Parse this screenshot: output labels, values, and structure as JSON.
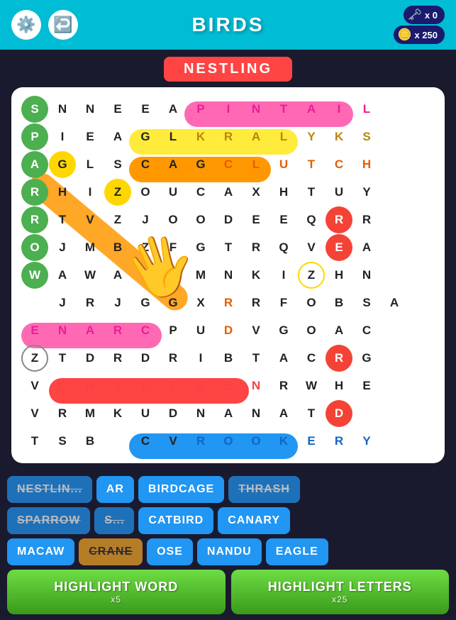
{
  "header": {
    "title": "BIRDS",
    "icons": {
      "settings": "⚙",
      "back": "↩"
    },
    "scores": {
      "key_icon": "🗝",
      "key_count": "x 0",
      "coin_icon": "🪙",
      "coin_count": "x 250"
    }
  },
  "word_label": "NESTLING",
  "grid": {
    "rows": [
      [
        "S",
        "N",
        "N",
        "E",
        "E",
        "A",
        "P",
        "I",
        "N",
        "T",
        "A",
        "I",
        "L",
        " "
      ],
      [
        "P",
        "I",
        "E",
        "A",
        "G",
        "L",
        "K",
        "R",
        "A",
        "L",
        "Y",
        "K",
        "S",
        " "
      ],
      [
        "A",
        "G",
        "L",
        "S",
        "C",
        "A",
        "G",
        "C",
        "L",
        "U",
        "T",
        "C",
        "H",
        " "
      ],
      [
        "R",
        "H",
        "I",
        "Z",
        "O",
        "U",
        "C",
        "A",
        "X",
        "H",
        "T",
        "U",
        "Y",
        " "
      ],
      [
        "R",
        "T",
        "V",
        "Z",
        "J",
        "O",
        "O",
        "D",
        "E",
        "E",
        "Q",
        "R",
        "R",
        " "
      ],
      [
        "O",
        "J",
        "M",
        "B",
        "Z",
        "F",
        "G",
        "T",
        "R",
        "Q",
        "V",
        "E",
        "A",
        " "
      ],
      [
        "W",
        "A",
        "W",
        "A",
        "C",
        "A",
        "M",
        "N",
        "K",
        "I",
        "Z",
        "H",
        "N",
        " "
      ],
      [
        " ",
        "J",
        "R",
        "J",
        "G",
        "G",
        "X",
        "R",
        "R",
        "F",
        "O",
        "B",
        "S",
        "A"
      ],
      [
        "E",
        "N",
        "A",
        "R",
        "C",
        "P",
        "U",
        "D",
        "V",
        "G",
        "O",
        "A",
        "C",
        " "
      ],
      [
        "Z",
        "T",
        "D",
        "R",
        "D",
        "R",
        "I",
        "B",
        "T",
        "A",
        "C",
        "R",
        "G",
        " "
      ],
      [
        "V",
        "C",
        "N",
        "I",
        "L",
        "T",
        "S",
        "E",
        "N",
        "R",
        "W",
        "H",
        "E",
        " "
      ],
      [
        "V",
        "R",
        "M",
        "K",
        "U",
        "D",
        "N",
        "A",
        "N",
        "A",
        "T",
        "D",
        " ",
        " "
      ],
      [
        "T",
        "S",
        "B",
        " ",
        "C",
        "V",
        "R",
        "O",
        "O",
        "K",
        "E",
        "R",
        "Y",
        " "
      ]
    ]
  },
  "word_chips": {
    "row1": [
      {
        "text": "NESTLIN",
        "style": "blue",
        "strikethrough": true
      },
      {
        "text": "AR",
        "style": "blue"
      },
      {
        "text": "BIRDCAGE",
        "style": "blue"
      },
      {
        "text": "THRASH",
        "style": "blue",
        "strikethrough": true
      }
    ],
    "row2": [
      {
        "text": "SPARROW",
        "style": "blue",
        "strikethrough": true
      },
      {
        "text": "S...",
        "style": "blue",
        "strikethrough": true
      },
      {
        "text": "CATBIRD",
        "style": "blue"
      },
      {
        "text": "CANARY",
        "style": "blue"
      }
    ],
    "row3": [
      {
        "text": "MACAW",
        "style": "blue"
      },
      {
        "text": "CRANE",
        "style": "yellow",
        "strikethrough": true
      },
      {
        "text": "OSE",
        "style": "blue"
      },
      {
        "text": "NANDU",
        "style": "blue"
      },
      {
        "text": "EAGLE",
        "style": "blue"
      }
    ]
  },
  "buttons": {
    "highlight_word": {
      "label": "HIGHLIGHT WORD",
      "sub": "x5"
    },
    "highlight_letters": {
      "label": "HIGHLIGHT LETTERS",
      "sub": "x25"
    }
  }
}
